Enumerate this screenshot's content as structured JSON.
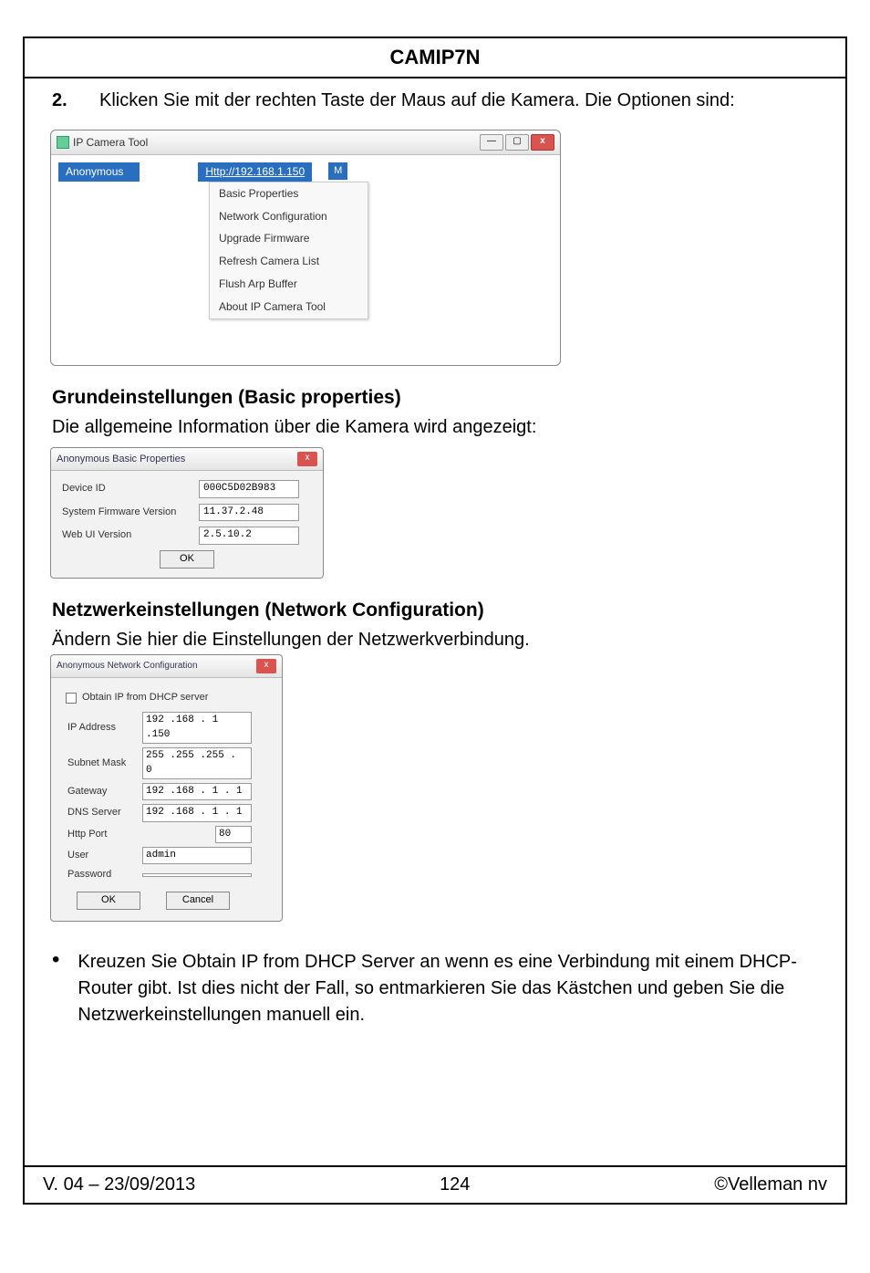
{
  "header": {
    "title": "CAMIP7N"
  },
  "step": {
    "num": "2.",
    "text": "Klicken Sie mit der rechten Taste der Maus auf die Kamera. Die Optionen sind:"
  },
  "screenshot1": {
    "title": "IP Camera Tool",
    "cam_name": "Anonymous",
    "cam_url": "Http://192.168.1.150",
    "cam_flag": "M",
    "menu": [
      "Basic Properties",
      "Network Configuration",
      "Upgrade Firmware",
      "Refresh Camera List",
      "Flush Arp Buffer",
      "About IP Camera Tool"
    ]
  },
  "section_bp": {
    "heading": "Grundeinstellungen (Basic properties)",
    "sub": "Die allgemeine Information über die Kamera wird angezeigt:"
  },
  "dlg_bp": {
    "title": "Anonymous Basic Properties",
    "rows": {
      "device_id_label": "Device ID",
      "device_id_value": "000C5D02B983",
      "fw_label": "System Firmware Version",
      "fw_value": "11.37.2.48",
      "webui_label": "Web UI Version",
      "webui_value": "2.5.10.2"
    },
    "ok": "OK"
  },
  "section_nc": {
    "heading": "Netzwerkeinstellungen (Network Configuration)",
    "sub": "Ändern Sie hier die Einstellungen der Netzwerkverbindung."
  },
  "dlg_nc": {
    "title": "Anonymous Network Configuration",
    "dhcp_label": "Obtain IP from DHCP server",
    "fields": {
      "ip_label": "IP Address",
      "ip_value": "192 .168 . 1 .150",
      "mask_label": "Subnet Mask",
      "mask_value": "255 .255 .255 . 0",
      "gw_label": "Gateway",
      "gw_value": "192 .168 . 1 .  1",
      "dns_label": "DNS Server",
      "dns_value": "192 .168 . 1 .  1",
      "port_label": "Http Port",
      "port_value": "80",
      "user_label": "User",
      "user_value": "admin",
      "pwd_label": "Password",
      "pwd_value": ""
    },
    "ok": "OK",
    "cancel": "Cancel"
  },
  "bullet": {
    "text": "Kreuzen Sie Obtain IP from DHCP Server an wenn es eine Verbindung mit einem DHCP-Router gibt. Ist dies nicht der Fall, so entmarkieren Sie das Kästchen und geben Sie die Netzwerkeinstellungen manuell ein."
  },
  "footer": {
    "left": "V. 04 – 23/09/2013",
    "center": "124",
    "right": "©Velleman nv"
  }
}
